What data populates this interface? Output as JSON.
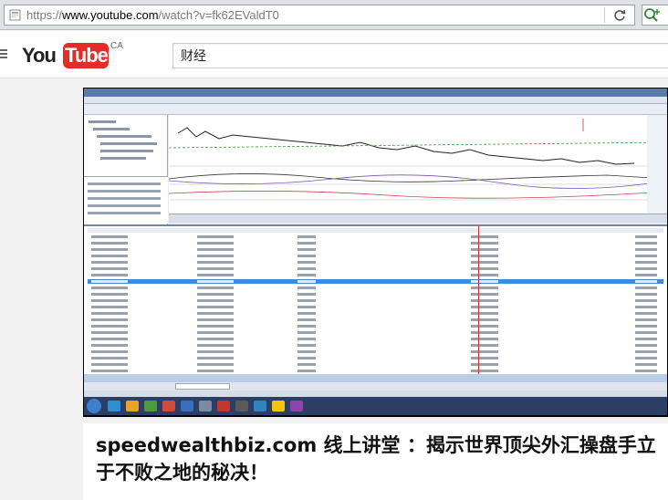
{
  "browser": {
    "url_scheme": "https://",
    "url_domain": "www.youtube.com",
    "url_path": "/watch?v=fk62EValdT0"
  },
  "masthead": {
    "logo_you": "You",
    "logo_tube": "Tube",
    "logo_region": "CA",
    "search_value": "财经"
  },
  "video": {
    "title": "speedwealthbiz.com 线上讲堂 ：揭示世界顶尖外汇操盘手立于不败之地的秘决！"
  },
  "colors": {
    "youtube_red": "#e52d27",
    "player_bg": "#000000",
    "highlight_row": "#3f8bd8"
  }
}
